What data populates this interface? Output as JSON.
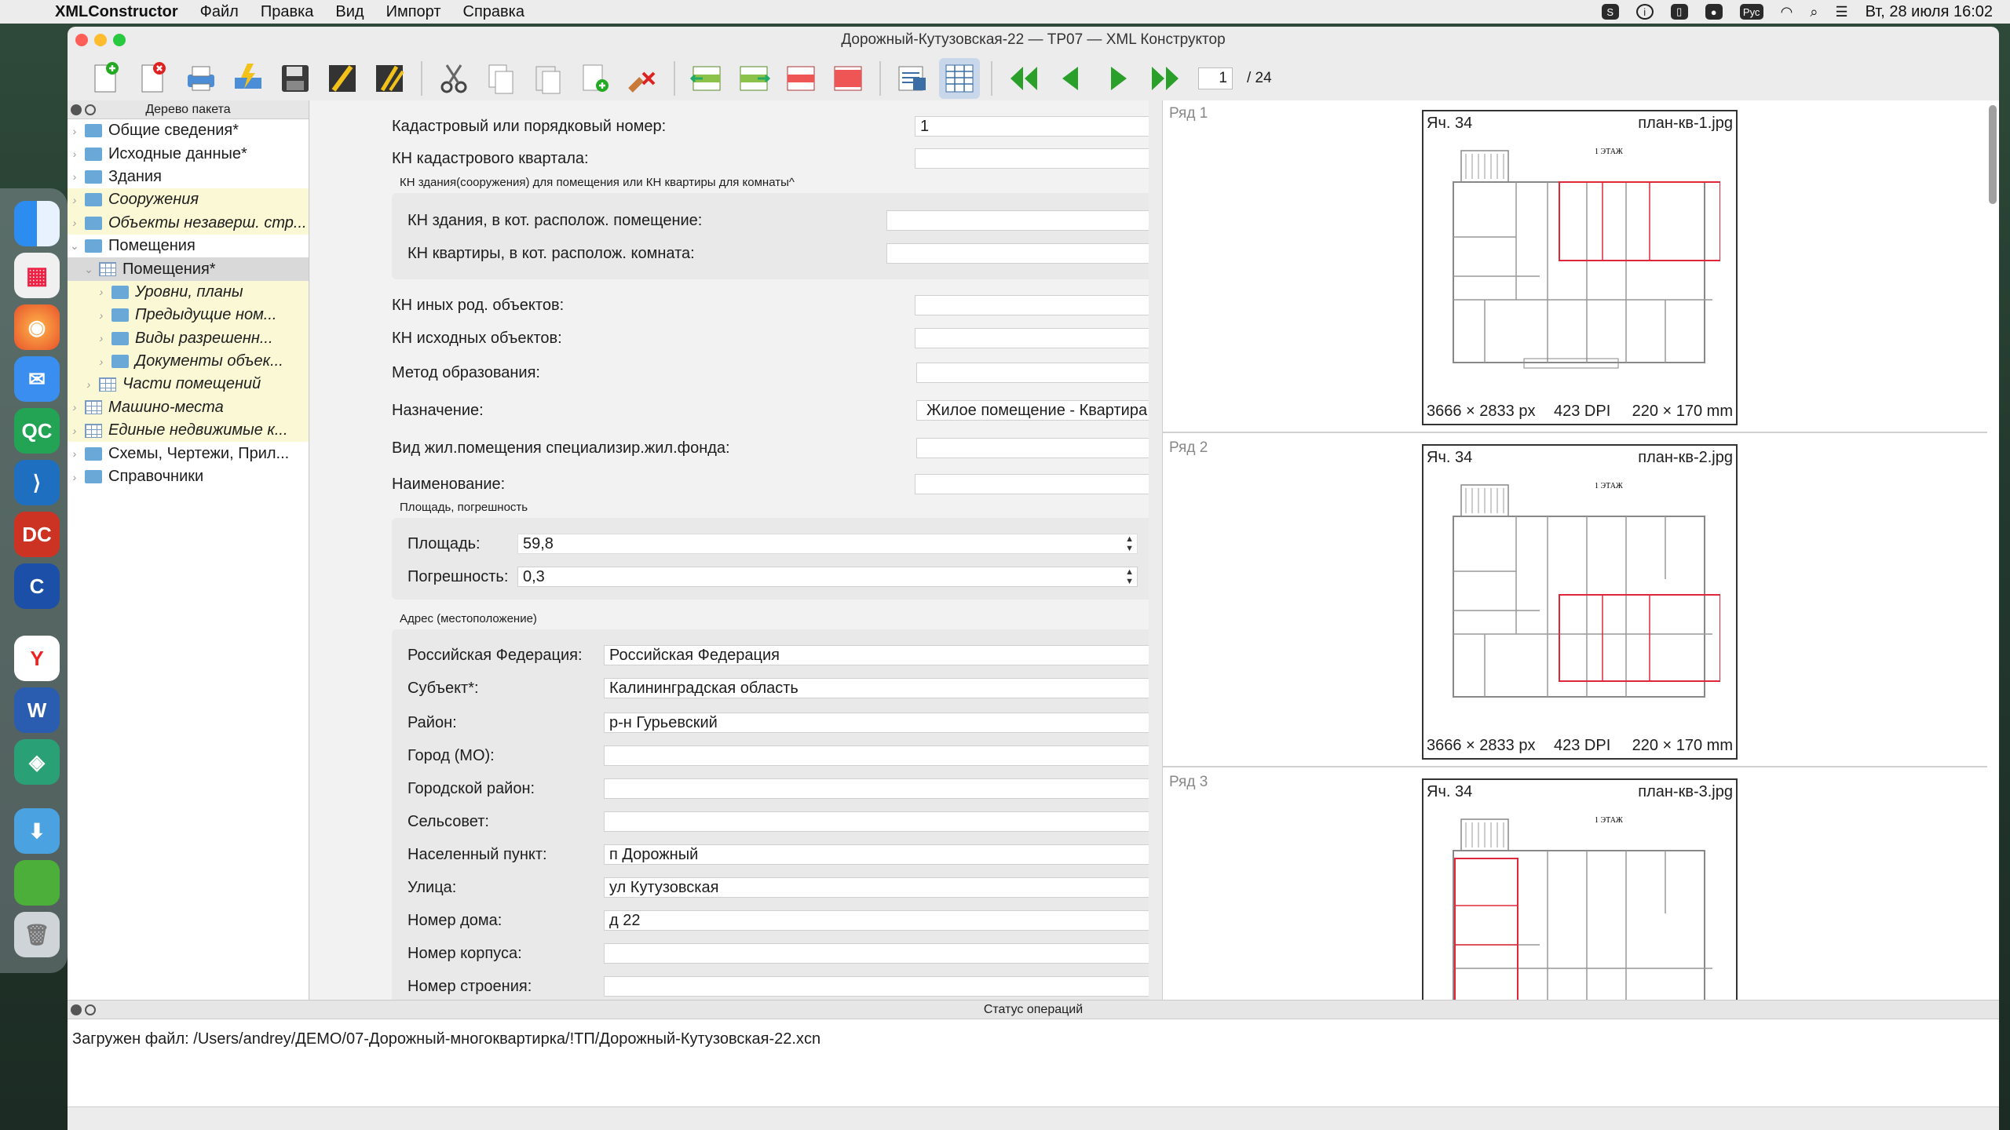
{
  "menubar": {
    "app_name": "XMLConstructor",
    "items": [
      "Файл",
      "Правка",
      "Вид",
      "Импорт",
      "Справка"
    ],
    "lang": "Рус",
    "clock": "Вт, 28 июля  16:02"
  },
  "window": {
    "title": "Дорожный-Кутузовская-22 — ТР07 — XML Конструктор"
  },
  "toolbar": {
    "page_current": "1",
    "page_total": "/ 24"
  },
  "tree": {
    "header": "Дерево пакета",
    "items": [
      {
        "label": "Общие сведения*"
      },
      {
        "label": "Исходные данные*"
      },
      {
        "label": "Здания"
      },
      {
        "label": "Сооружения"
      },
      {
        "label": "Объекты незаверш. стр..."
      },
      {
        "label": "Помещения"
      },
      {
        "label": "Помещения*"
      },
      {
        "label": "Уровни, планы"
      },
      {
        "label": "Предыдущие ном..."
      },
      {
        "label": "Виды разрешенн..."
      },
      {
        "label": "Документы объек..."
      },
      {
        "label": "Части помещений"
      },
      {
        "label": "Машино-места"
      },
      {
        "label": "Единые недвижимые к..."
      },
      {
        "label": "Схемы, Чертежи, Прил..."
      },
      {
        "label": "Справочники"
      }
    ]
  },
  "form": {
    "cadastral_label": "Кадастровый или порядковый номер:",
    "cadastral_value": "1",
    "quarter_label": "КН кадастрового квартала:",
    "building_group_title": "КН здания(сооружения) для помещения или КН квартиры для комнаты^",
    "building_kn_label": "КН здания, в кот. располож. помещение:",
    "flat_kn_label": "КН квартиры, в кот. располож. комната:",
    "other_kn_label": "КН иных род. объектов:",
    "source_kn_label": "КН исходных объектов:",
    "method_label": "Метод образования:",
    "purpose_label": "Назначение:",
    "purpose_value": "Жилое помещение - Квартира",
    "special_label": "Вид жил.помещения специализир.жил.фонда:",
    "name_label": "Наименование:",
    "area_group_title": "Площадь, погрешность",
    "area_label": "Площадь:",
    "area_value": "59,8",
    "error_label": "Погрешность:",
    "error_value": "0,3",
    "address_group_title": "Адрес (местоположение)",
    "country_label": "Российская Федерация:",
    "country_value": "Российская Федерация",
    "subject_label": "Субъект*:",
    "subject_value": "Калининградская область",
    "district_label": "Район:",
    "district_value": "р-н Гурьевский",
    "city_label": "Город (МО):",
    "city_district_label": "Городской район:",
    "council_label": "Сельсовет:",
    "settlement_label": "Населенный пункт:",
    "settlement_value": "п Дорожный",
    "street_label": "Улица:",
    "street_value": "ул Кутузовская",
    "house_label": "Номер дома:",
    "house_value": "д 22",
    "block_label": "Номер корпуса:",
    "building_label": "Номер строения:"
  },
  "preview": {
    "rows": [
      {
        "row": "Ряд 1",
        "cell": "Яч. 34",
        "file": "план-кв-1.jpg",
        "px": "3666 × 2833 px",
        "dpi": "423 DPI",
        "mm": "220 × 170 mm"
      },
      {
        "row": "Ряд 2",
        "cell": "Яч. 34",
        "file": "план-кв-2.jpg",
        "px": "3666 × 2833 px",
        "dpi": "423 DPI",
        "mm": "220 × 170 mm"
      },
      {
        "row": "Ряд 3",
        "cell": "Яч. 34",
        "file": "план-кв-3.jpg"
      }
    ],
    "plan_caption": "1 ЭТАЖ"
  },
  "status": {
    "header": "Статус операций",
    "message": "Загружен файл: /Users/andrey/ДЕМО/07-Дорожный-многоквартирка/!ТП/Дорожный-Кутузовская-22.xcn"
  },
  "colors": {
    "accent": "#2e7cf6",
    "highlight_row": "#fbf8d6",
    "plan_highlight": "#e0283a"
  }
}
